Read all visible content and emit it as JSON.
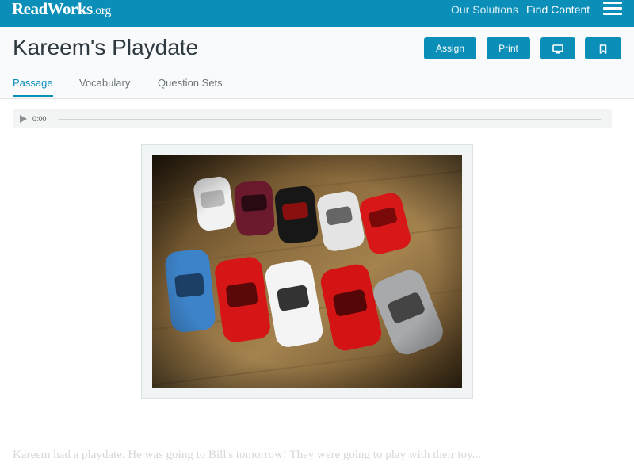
{
  "topbar": {
    "logo_text": "ReadWorks",
    "logo_suffix": ".org",
    "nav_solutions": "Our Solutions",
    "nav_find": "Find Content",
    "brand_color": "#0b8fb8"
  },
  "header": {
    "title": "Kareem's Playdate",
    "buttons": {
      "assign": "Assign",
      "print": "Print",
      "present_icon": "monitor-icon",
      "bookmark_icon": "bookmark-icon"
    },
    "tabs": [
      {
        "label": "Passage",
        "active": true
      },
      {
        "label": "Vocabulary",
        "active": false
      },
      {
        "label": "Question Sets",
        "active": false
      }
    ]
  },
  "audio": {
    "time": "0:00",
    "progress": 0
  },
  "passage": {
    "text": "Kareem had a playdate. He was going to Bill's tomorrow! They were going to play with their toy..."
  }
}
